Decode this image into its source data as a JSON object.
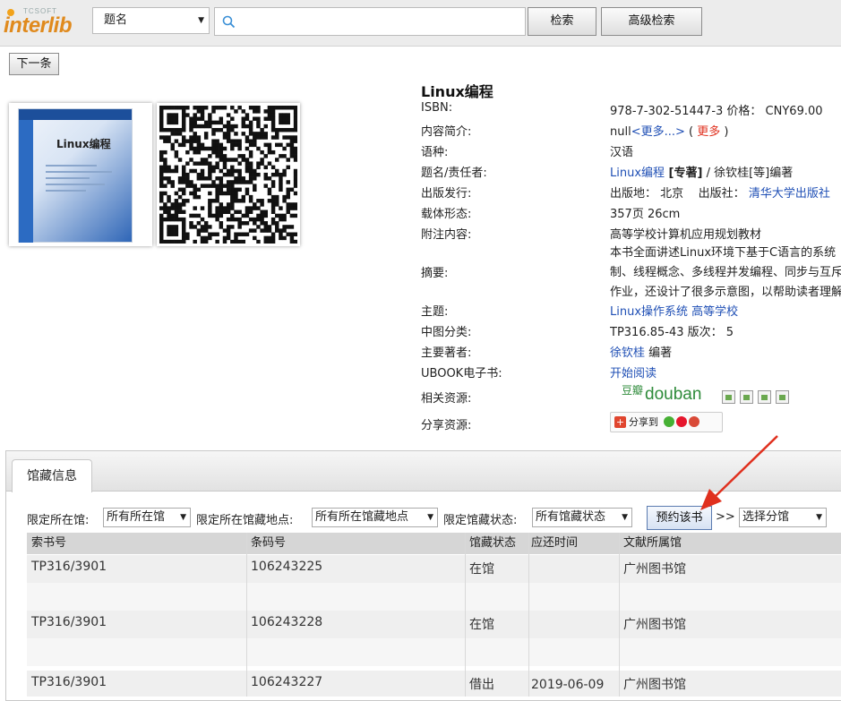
{
  "header": {
    "logo_sub": "TCSOFT",
    "logo_text": "interlib",
    "search_field": "题名",
    "search_value": "",
    "search_button": "检索",
    "advanced_button": "高级检索"
  },
  "nav": {
    "next_button": "下一条"
  },
  "book": {
    "title": "Linux编程",
    "cover_title": "Linux编程",
    "fields": {
      "isbn_label": "ISBN:",
      "isbn_value": "978-7-302-51447-3 价格： CNY69.00",
      "intro_label": "内容简介:",
      "intro_null": "null",
      "intro_more": "<更多...>",
      "intro_paren_open": "(",
      "intro_more_red": "更多",
      "intro_paren_close": ")",
      "lang_label": "语种:",
      "lang_value": "汉语",
      "title_resp_label": "题名/责任者:",
      "title_resp_link": "Linux编程",
      "title_resp_bold": " [专著]",
      "title_resp_rest": " / 徐钦桂[等]编著",
      "pub_label": "出版发行:",
      "pub_place_label": "出版地： 北京",
      "pub_house_label": "出版社：",
      "pub_house_value": "清华大学出版社",
      "form_label": "载体形态:",
      "form_value": "357页 26cm",
      "note_label": "附注内容:",
      "note_value": "高等学校计算机应用规划教材",
      "abstract_label": "摘要:",
      "abstract_line1": "本书全面讲述Linux环境下基于C语言的系统",
      "abstract_line2": "制、线程概念、多线程并发编程、同步与互斥",
      "abstract_line3": "作业，还设计了很多示意图，以帮助读者理解",
      "subject_label": "主题:",
      "subject_link1": "Linux操作系统",
      "subject_link2": "高等学校",
      "clc_label": "中图分类:",
      "clc_value": "TP316.85-43 版次： 5",
      "author_label": "主要著者:",
      "author_link": "徐钦桂",
      "author_role": " 编著",
      "ubook_label": "UBOOK电子书:",
      "ubook_link": "开始阅读",
      "related_label": "相关资源:",
      "douban_cn": "豆瓣",
      "douban_en": "douban",
      "share_label": "分享资源:",
      "share_text": "分享到"
    }
  },
  "holdings": {
    "tab": "馆藏信息",
    "filters": {
      "lib_label": "限定所在馆:",
      "lib_value": "所有所在馆",
      "loc_label": "限定所在馆藏地点:",
      "loc_value": "所有所在馆藏地点",
      "status_label": "限定馆藏状态:",
      "status_value": "所有馆藏状态",
      "reserve_button": "预约该书",
      "sep": ">>",
      "branch_value": "选择分馆"
    },
    "columns": [
      "索书号",
      "条码号",
      "馆藏状态",
      "应还时间",
      "文献所属馆"
    ],
    "rows": [
      [
        "TP316/3901",
        "106243225",
        "在馆",
        "",
        "广州图书馆"
      ],
      [
        "TP316/3901",
        "106243228",
        "在馆",
        "",
        "广州图书馆"
      ],
      [
        "TP316/3901",
        "106243227",
        "借出",
        "2019-06-09",
        "广州图书馆"
      ]
    ]
  },
  "colors": {
    "link": "#1f4fb5",
    "accent_red": "#e0301e",
    "arrow": "#e0301e"
  }
}
